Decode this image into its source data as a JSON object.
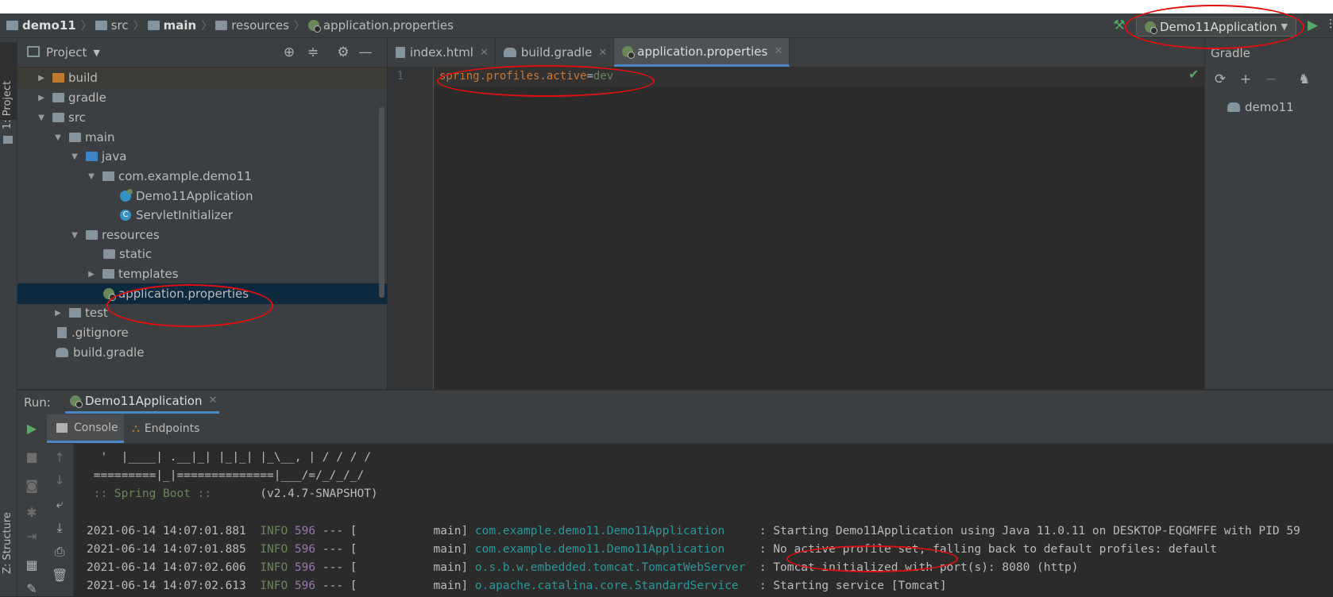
{
  "breadcrumb": {
    "items": [
      "demo11",
      "src",
      "main",
      "resources",
      "application.properties"
    ]
  },
  "run_config": {
    "label": "Demo11Application"
  },
  "left_stripe": {
    "project_tab": "1: Project",
    "structure_tab": "Z: Structure"
  },
  "project_panel": {
    "title": "Project",
    "tree": [
      {
        "label": "build"
      },
      {
        "label": "gradle"
      },
      {
        "label": "src"
      },
      {
        "label": "main"
      },
      {
        "label": "java"
      },
      {
        "label": "com.example.demo11"
      },
      {
        "label": "Demo11Application"
      },
      {
        "label": "ServletInitializer"
      },
      {
        "label": "resources"
      },
      {
        "label": "static"
      },
      {
        "label": "templates"
      },
      {
        "label": "application.properties"
      },
      {
        "label": "test"
      },
      {
        "label": ".gitignore"
      },
      {
        "label": "build.gradle"
      }
    ]
  },
  "editor": {
    "tabs": [
      {
        "label": "index.html"
      },
      {
        "label": "build.gradle"
      },
      {
        "label": "application.properties"
      }
    ],
    "line_number": "1",
    "code": {
      "key": "spring.profiles.active",
      "eq": "=",
      "value": "dev"
    }
  },
  "gradle_panel": {
    "title": "Gradle",
    "project": "demo11"
  },
  "run_panel": {
    "label": "Run:",
    "tab": "Demo11Application",
    "subtabs": [
      "Console",
      "Endpoints"
    ],
    "console": {
      "banner1": "  '  |____| .__|_| |_|_| |_\\__, | / / / /",
      "banner2": " =========|_|==============|___/=/_/_/_/",
      "banner3_a": " :: Spring Boot :: ",
      "banner3_b": "      (v2.4.7-SNAPSHOT)",
      "logs": [
        {
          "ts": "2021-06-14 14:07:01.881",
          "level": "INFO",
          "pid": "596",
          "mid": " --- [           main] ",
          "logger": "com.example.demo11.Demo11Application    ",
          "msg": " : Starting Demo11Application using Java 11.0.11 on DESKTOP-EQGMFFE with PID 59"
        },
        {
          "ts": "2021-06-14 14:07:01.885",
          "level": "INFO",
          "pid": "596",
          "mid": " --- [           main] ",
          "logger": "com.example.demo11.Demo11Application    ",
          "msg": " : No active profile set, falling back to default profiles: default"
        },
        {
          "ts": "2021-06-14 14:07:02.606",
          "level": "INFO",
          "pid": "596",
          "mid": " --- [           main] ",
          "logger": "o.s.b.w.embedded.tomcat.TomcatWebServer ",
          "msg": " : Tomcat initialized with port(s): 8080 (http)"
        },
        {
          "ts": "2021-06-14 14:07:02.613",
          "level": "INFO",
          "pid": "596",
          "mid": " --- [           main] ",
          "logger": "o.apache.catalina.core.StandardService  ",
          "msg": " : Starting service [Tomcat]"
        }
      ]
    }
  },
  "colors": {
    "annotation": "#e01010",
    "accent": "#4a88c7",
    "run_green": "#59a869"
  }
}
